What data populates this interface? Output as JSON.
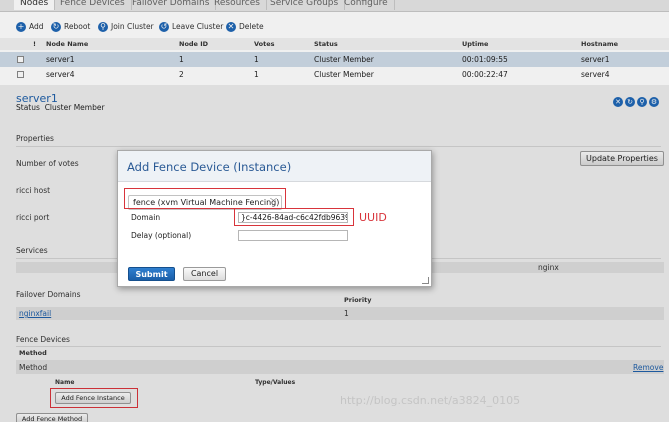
{
  "tabs": [
    "Nodes",
    "Fence Devices",
    "Failover Domains",
    "Resources",
    "Service Groups",
    "Configure"
  ],
  "toolbar": {
    "add": "Add",
    "reboot": "Reboot",
    "join_cluster": "Join Cluster",
    "leave_cluster": "Leave Cluster",
    "delete": "Delete"
  },
  "nodes_table": {
    "columns": [
      "!",
      "Node Name",
      "Node ID",
      "Votes",
      "Status",
      "Uptime",
      "Hostname"
    ],
    "rows": [
      {
        "name": "server1",
        "id": "1",
        "votes": "1",
        "status": "Cluster Member",
        "uptime": "00:01:09:55",
        "hostname": "server1",
        "selected": true
      },
      {
        "name": "server4",
        "id": "2",
        "votes": "1",
        "status": "Cluster Member",
        "uptime": "00:00:22:47",
        "hostname": "server4",
        "selected": false
      }
    ]
  },
  "node_detail": {
    "name": "server1",
    "status_label": "Status",
    "status_value": "Cluster Member",
    "properties_heading": "Properties",
    "number_of_votes": "Number of votes",
    "ricci_host": "ricci host",
    "ricci_port": "ricci port",
    "update_button": "Update Properties",
    "services_heading": "Services",
    "services_value": "nginx",
    "failover_heading": "Failover Domains",
    "priority_header": "Priority",
    "failover_domain": "nginxfail",
    "failover_priority": "1",
    "fence_heading": "Fence Devices",
    "method_header": "Method",
    "method_label": "Method",
    "remove_link": "Remove",
    "name_header": "Name",
    "type_values_header": "Type/Values",
    "add_fence_instance": "Add Fence Instance",
    "add_fence_method": "Add Fence Method"
  },
  "dialog": {
    "title": "Add Fence Device (Instance)",
    "select_value": "fence (xvm Virtual Machine Fencing)",
    "domain_label": "Domain",
    "domain_value": "}c-4426-84ad-c6c42fdb9639",
    "delay_label": "Delay (optional)",
    "delay_value": "",
    "submit": "Submit",
    "cancel": "Cancel"
  },
  "annotation": "UUID",
  "watermark": "http://blog.csdn.net/a3824_0105",
  "colors": {
    "accent": "#1f67b5",
    "highlight": "#d8343b",
    "title_blue": "#2a5a95"
  }
}
